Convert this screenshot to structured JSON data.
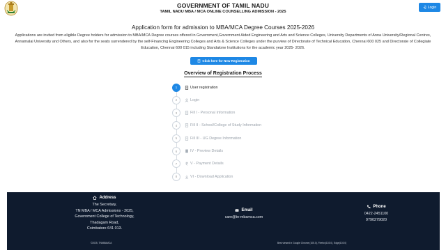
{
  "header": {
    "title": "GOVERNMENT OF TAMIL NADU",
    "subtitle": "TAMIL NADU MBA / MCA ONLINE COUNSELLING ADMISSION - 2025",
    "login_label": "Login"
  },
  "main": {
    "form_title": "Application form for admission to MBA/MCA Degree Courses 2025-2026",
    "intro": "Applications are invited from eligible Degree holders for admission to MBA/MCA Degree courses offered in Government,Government Aided Engineering and Arts and Science Colleges, University Departments of Anna University/Regional Centres, Annamalai University and Others, and also for the seats surrendered by the self-Financing Engineering Colleges and Arts & Science Colleges under the purview of Directorate of Technical Education, Chennai 600 025 and Directorate of Collegiate Education, Chennai 600 015 including Standalone Institutions for the academic year 2025- 2026.",
    "new_registration_label": "Click here for New Registration",
    "overview_title": "Overview of Registration Process"
  },
  "steps": [
    {
      "num": "1",
      "label": "User registration",
      "icon": "form-icon",
      "active": true
    },
    {
      "num": "2",
      "label": "Login",
      "icon": "user-icon",
      "active": false
    },
    {
      "num": "3",
      "label": "Fill I - Personal Information",
      "icon": "form-icon",
      "active": false
    },
    {
      "num": "4",
      "label": "Fill II - School/College of Study Information",
      "icon": "form-icon",
      "active": false
    },
    {
      "num": "5",
      "label": "Fill III - UG Degree Information",
      "icon": "form-icon",
      "active": false
    },
    {
      "num": "6",
      "label": "IV - Preview Details",
      "icon": "document-icon",
      "active": false
    },
    {
      "num": "7",
      "label": "V - Payment Details",
      "icon": "rupee-icon",
      "active": false
    },
    {
      "num": "8",
      "label": "VI - Download Application",
      "icon": "download-icon",
      "active": false
    }
  ],
  "footer": {
    "address_heading": "Address",
    "address_lines": [
      "The Secretary,",
      "TN MBA / MCA Admissions - 2025,",
      "Government College of Technology,",
      "Thadagam Road,",
      "Coimbatore 641 013."
    ],
    "email_heading": "Email",
    "email": "care@tn-mbamca.com",
    "phone_heading": "Phone",
    "phones": [
      "0422-2451100",
      "9790279020"
    ],
    "copyright": "©2025, TNMBAMCA",
    "browser_note": "Best viewed in Google Chrome (105.0), Firefox(103.0), Edge(103.0)"
  },
  "colors": {
    "accent": "#1e88e5",
    "footer_bg": "#0f1b2e"
  }
}
